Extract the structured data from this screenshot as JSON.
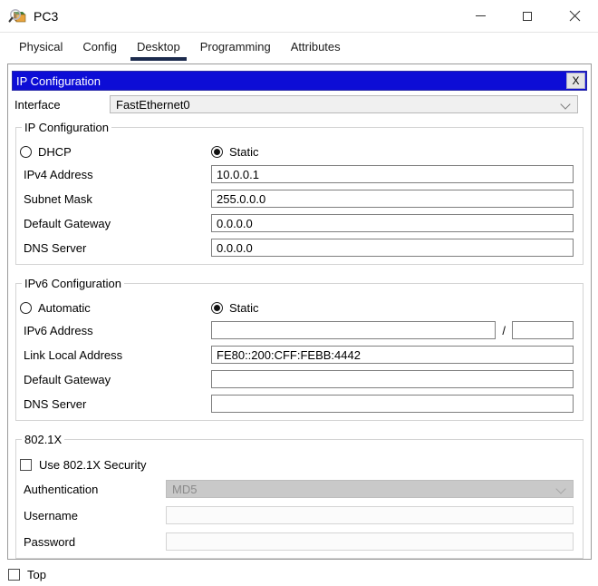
{
  "window": {
    "title": "PC3"
  },
  "tabs": {
    "active": "Desktop",
    "items": [
      {
        "label": "Physical"
      },
      {
        "label": "Config"
      },
      {
        "label": "Desktop"
      },
      {
        "label": "Programming"
      },
      {
        "label": "Attributes"
      }
    ]
  },
  "dialog": {
    "title": "IP Configuration",
    "close_label": "X"
  },
  "interface_row": {
    "label": "Interface",
    "value": "FastEthernet0"
  },
  "ip_configuration": {
    "legend": "IP Configuration",
    "dhcp_label": "DHCP",
    "static_label": "Static",
    "selected_mode": "Static",
    "ipv4_address": {
      "label": "IPv4 Address",
      "value": "10.0.0.1"
    },
    "subnet_mask": {
      "label": "Subnet Mask",
      "value": "255.0.0.0"
    },
    "default_gateway": {
      "label": "Default Gateway",
      "value": "0.0.0.0"
    },
    "dns_server": {
      "label": "DNS Server",
      "value": "0.0.0.0"
    }
  },
  "ipv6_configuration": {
    "legend": "IPv6 Configuration",
    "automatic_label": "Automatic",
    "static_label": "Static",
    "selected_mode": "Static",
    "ipv6_address": {
      "label": "IPv6 Address",
      "value": "",
      "prefix_separator": "/",
      "prefix_value": ""
    },
    "link_local_address": {
      "label": "Link Local Address",
      "value": "FE80::200:CFF:FEBB:4442"
    },
    "default_gateway": {
      "label": "Default Gateway",
      "value": ""
    },
    "dns_server": {
      "label": "DNS Server",
      "value": ""
    }
  },
  "dot1x": {
    "legend": "802.1X",
    "use_security_label": "Use 802.1X Security",
    "use_security_checked": false,
    "authentication": {
      "label": "Authentication",
      "value": "MD5"
    },
    "username": {
      "label": "Username",
      "value": ""
    },
    "password": {
      "label": "Password",
      "value": ""
    }
  },
  "footer": {
    "top_label": "Top",
    "top_checked": false
  },
  "colors": {
    "dialog_header_blue": "#0d0dd6",
    "tab_underline_navy": "#1c2b4d",
    "disabled_combo_gray": "#c9c9c9"
  }
}
